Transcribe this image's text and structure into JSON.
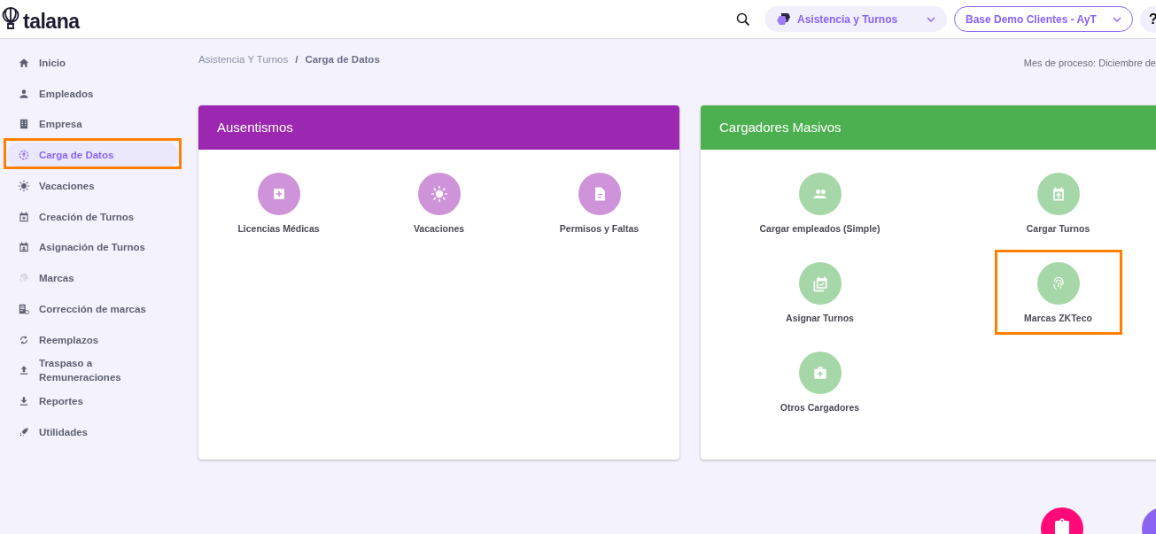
{
  "header": {
    "logo": "talana",
    "module_selector": {
      "label": "Asistencia y Turnos"
    },
    "company_selector": {
      "label": "Base Demo Clientes - AyT"
    },
    "help": "?"
  },
  "sidebar": {
    "items": [
      {
        "label": "Inicio",
        "selected": false,
        "highlighted": false
      },
      {
        "label": "Empleados",
        "selected": false,
        "highlighted": false
      },
      {
        "label": "Empresa",
        "selected": false,
        "highlighted": false
      },
      {
        "label": "Carga de Datos",
        "selected": true,
        "highlighted": true
      },
      {
        "label": "Vacaciones",
        "selected": false,
        "highlighted": false
      },
      {
        "label": "Creación de Turnos",
        "selected": false,
        "highlighted": false
      },
      {
        "label": "Asignación de Turnos",
        "selected": false,
        "highlighted": false
      },
      {
        "label": "Marcas",
        "selected": false,
        "highlighted": false
      },
      {
        "label": "Corrección de marcas",
        "selected": false,
        "highlighted": false
      },
      {
        "label": "Reemplazos",
        "selected": false,
        "highlighted": false
      },
      {
        "label": "Traspaso a Remuneraciones",
        "selected": false,
        "highlighted": false
      },
      {
        "label": "Reportes",
        "selected": false,
        "highlighted": false
      },
      {
        "label": "Utilidades",
        "selected": false,
        "highlighted": false
      }
    ]
  },
  "breadcrumb": {
    "separator": "/",
    "items": [
      {
        "label": "Asistencia Y Turnos",
        "current": false
      },
      {
        "label": "Carga de Datos",
        "current": true
      }
    ]
  },
  "process_month": "Mes de proceso: Diciembre de",
  "panels": [
    {
      "title": "Ausentismos",
      "color": "#9c27b0",
      "items": [
        {
          "label": "Licencias Médicas",
          "highlighted": false
        },
        {
          "label": "Vacaciones",
          "highlighted": false
        },
        {
          "label": "Permisos y Faltas",
          "highlighted": false
        }
      ]
    },
    {
      "title": "Cargadores Masivos",
      "color": "#4caf50",
      "items": [
        {
          "label": "Cargar empleados (Simple)",
          "highlighted": false
        },
        {
          "label": "Cargar Turnos",
          "highlighted": false
        },
        {
          "label": "Asignar Turnos",
          "highlighted": false
        },
        {
          "label": "Marcas ZKTeco",
          "highlighted": true
        },
        {
          "label": "Otros Cargadores",
          "highlighted": false
        }
      ]
    }
  ]
}
